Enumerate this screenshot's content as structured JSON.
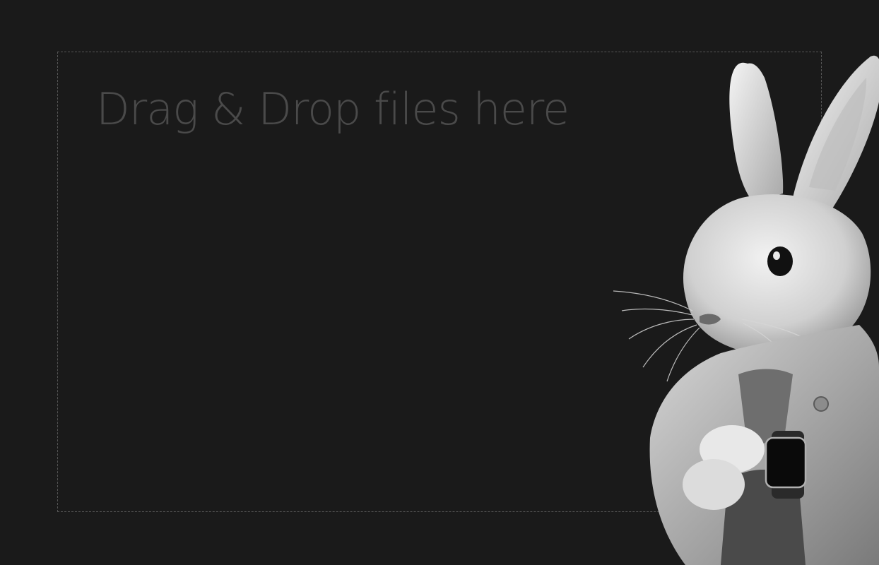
{
  "drop_zone": {
    "label": "Drag & Drop files here"
  },
  "mascot": {
    "icon": "rabbit-with-smartwatch-illustration"
  },
  "colors": {
    "background": "#1a1a1a",
    "border": "#555555",
    "text": "#4a4a4a"
  }
}
